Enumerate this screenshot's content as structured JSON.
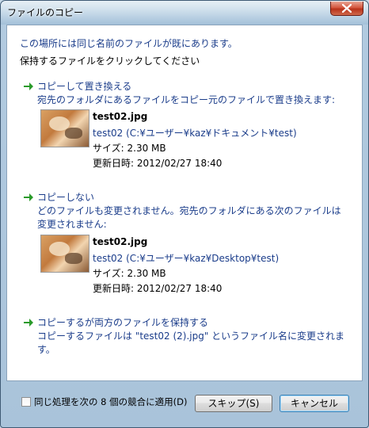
{
  "window": {
    "title": "ファイルのコピー"
  },
  "message": {
    "line1": "この場所には同じ名前のファイルが既にあります。",
    "line2": "保持するファイルをクリックしてください"
  },
  "options": [
    {
      "title": "コピーして置き換える",
      "description": "宛先のフォルダにあるファイルをコピー元のファイルで置き換えます:",
      "file": {
        "name": "test02.jpg",
        "path": "test02 (C:¥ユーザー¥kaz¥ドキュメント¥test)",
        "size": "サイズ: 2.30 MB",
        "modified": "更新日時: 2012/02/27 18:40"
      }
    },
    {
      "title": "コピーしない",
      "description_line1": "どのファイルも変更されません。宛先のフォルダにある次のファイルは",
      "description_line2": "変更されません:",
      "file": {
        "name": "test02.jpg",
        "path": "test02 (C:¥ユーザー¥kaz¥Desktop¥test)",
        "size": "サイズ: 2.30 MB",
        "modified": "更新日時: 2012/02/27 18:40"
      }
    },
    {
      "title": "コピーするが両方のファイルを保持する",
      "description_line1": "コピーするファイルは \"test02 (2).jpg\" というファイル名に変更されま",
      "description_line2": "す。"
    }
  ],
  "footer": {
    "checkbox_label": "同じ処理を次の 8 個の競合に適用(D)",
    "skip_label": "スキップ(S)",
    "cancel_label": "キャンセル"
  },
  "colors": {
    "link_blue": "#1a3c8a",
    "arrow_green": "#2a9a2a"
  }
}
